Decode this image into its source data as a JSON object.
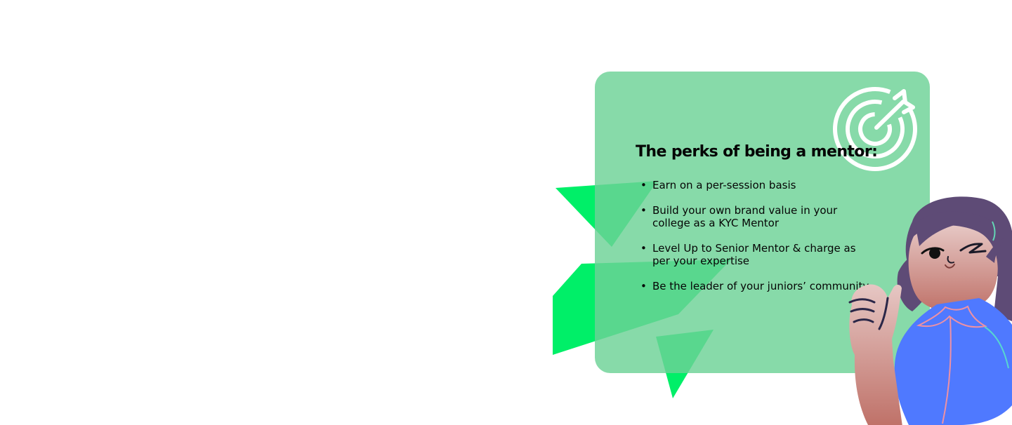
{
  "mentor_perks": {
    "title": "The perks of being a mentor:",
    "perks": [
      {
        "text": "Earn on a per-session basis"
      },
      {
        "text": "Build your own brand value in your college as a KYC Mentor"
      },
      {
        "text": "Level Up to Senior Mentor & charge as per your expertise"
      },
      {
        "text": "Be the leader of your juniors’ community"
      }
    ],
    "bullet": "•"
  },
  "icons": {
    "target": "target-icon",
    "illustration": "winking-mentor-thumbs-up-illustration"
  },
  "colors": {
    "page_background": "#ffffff",
    "card_background": "#84d9aa",
    "accent_green": "#00f06a",
    "text": "#050505",
    "icon_white": "#ffffff",
    "shirt_blue": "#4f79ff",
    "hair_purple": "#5e4b76"
  }
}
